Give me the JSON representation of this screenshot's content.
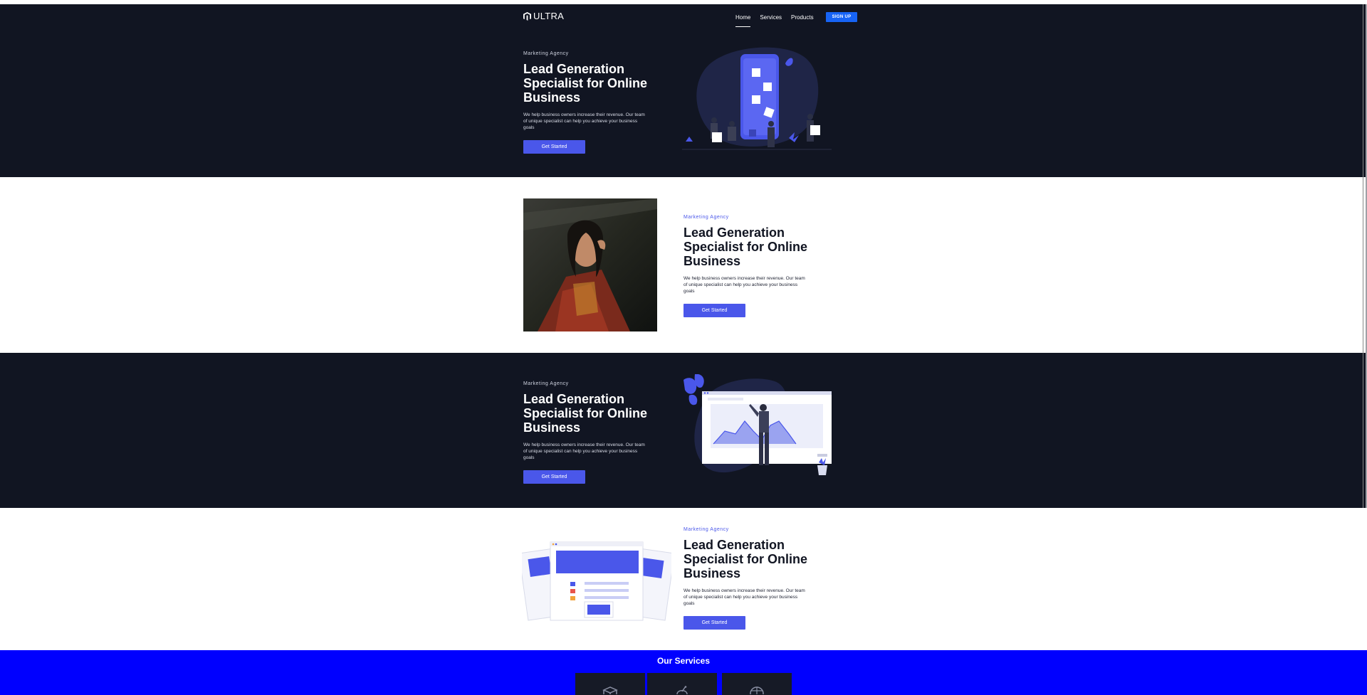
{
  "nav": {
    "logo_text": "ULTRA",
    "links": [
      "Home",
      "Services",
      "Products"
    ],
    "active_link": "Home",
    "signup_label": "SIGN UP"
  },
  "sections": [
    {
      "theme": "dark",
      "eyebrow": "Marketing Agency",
      "headline": "Lead Generation Specialist for Online Business",
      "body": "We help business owners increase their revenue. Our team of unique specialist can help you achieve your business goals",
      "cta": "Get Started",
      "illustration": "mobile-marketing-illustration"
    },
    {
      "theme": "light",
      "eyebrow": "Marketing Agency",
      "headline": "Lead Generation Specialist for Online Business",
      "body": "We help business owners increase their revenue. Our team of unique specialist can help you achieve your business goals",
      "cta": "Get Started",
      "illustration": "woman-portrait-photo"
    },
    {
      "theme": "dark",
      "eyebrow": "Marketing Agency",
      "headline": "Lead Generation Specialist for Online Business",
      "body": "We help business owners increase their revenue. Our team of unique specialist can help you achieve your business goals",
      "cta": "Get Started",
      "illustration": "analytics-dashboard-illustration"
    },
    {
      "theme": "light",
      "eyebrow": "Marketing Agency",
      "headline": "Lead Generation Specialist for Online Business",
      "body": "We help business owners increase their revenue. Our team of unique specialist can help you achieve your business goals",
      "cta": "Get Started",
      "illustration": "web-pages-illustration"
    }
  ],
  "services": {
    "title": "Our Services",
    "cards": [
      {
        "icon": "box-icon"
      },
      {
        "icon": "satellite-icon"
      },
      {
        "icon": "wheel-icon"
      }
    ]
  },
  "colors": {
    "dark_bg": "#111522",
    "accent": "#4a57ea",
    "signup": "#1764f5",
    "services_bg": "#0000ff"
  }
}
